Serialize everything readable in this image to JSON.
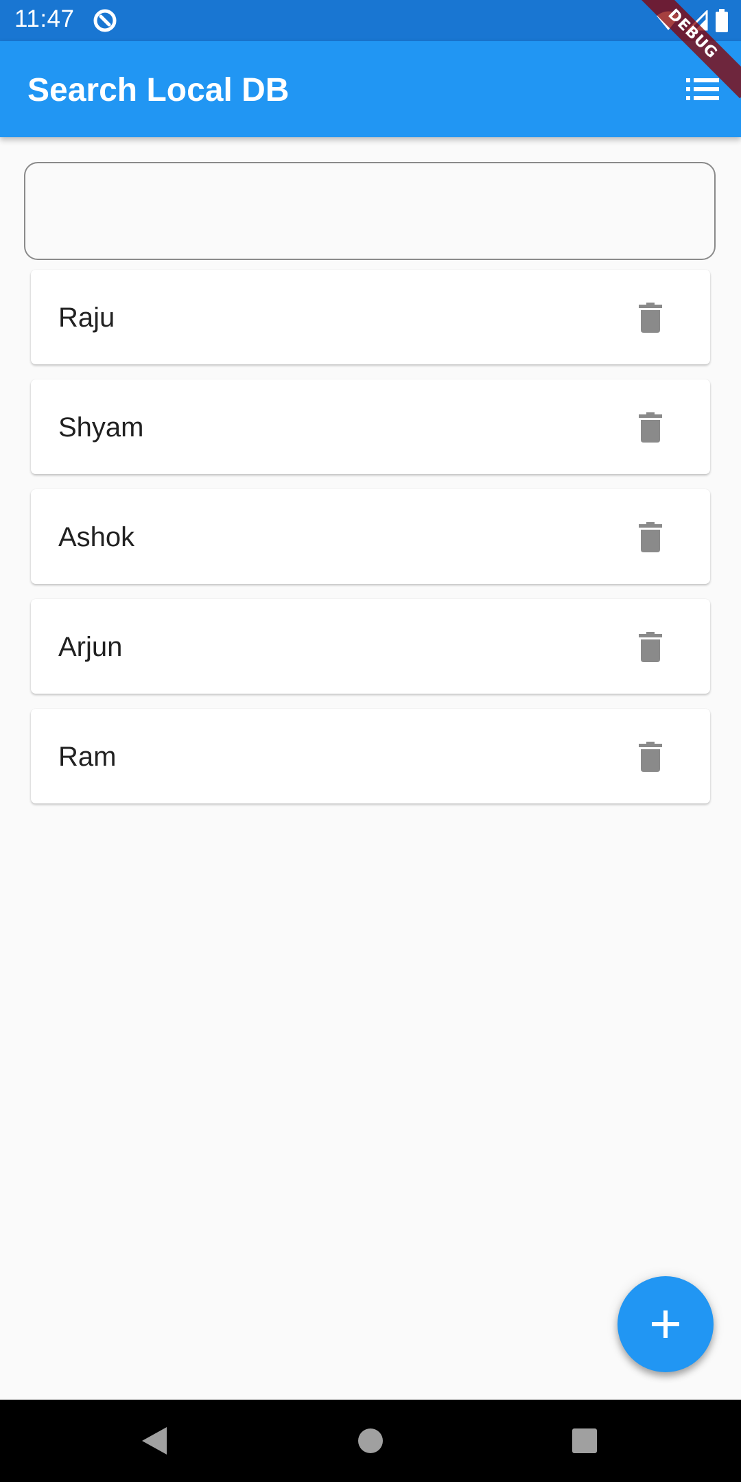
{
  "status_bar": {
    "time": "11:47",
    "background": "#1976d2"
  },
  "debug_banner": {
    "label": "DEBUG"
  },
  "app_bar": {
    "title": "Search Local DB",
    "action_icon": "list-icon",
    "background": "#2196f3"
  },
  "search": {
    "value": "",
    "placeholder": ""
  },
  "items": [
    {
      "name": "Raju",
      "action_icon": "delete-icon"
    },
    {
      "name": "Shyam",
      "action_icon": "delete-icon"
    },
    {
      "name": "Ashok",
      "action_icon": "delete-icon"
    },
    {
      "name": "Arjun",
      "action_icon": "delete-icon"
    },
    {
      "name": "Ram",
      "action_icon": "delete-icon"
    }
  ],
  "fab": {
    "icon": "add-icon",
    "background": "#2196f3"
  },
  "nav_bar": {
    "buttons": [
      "back-icon",
      "home-icon",
      "recents-icon"
    ]
  }
}
